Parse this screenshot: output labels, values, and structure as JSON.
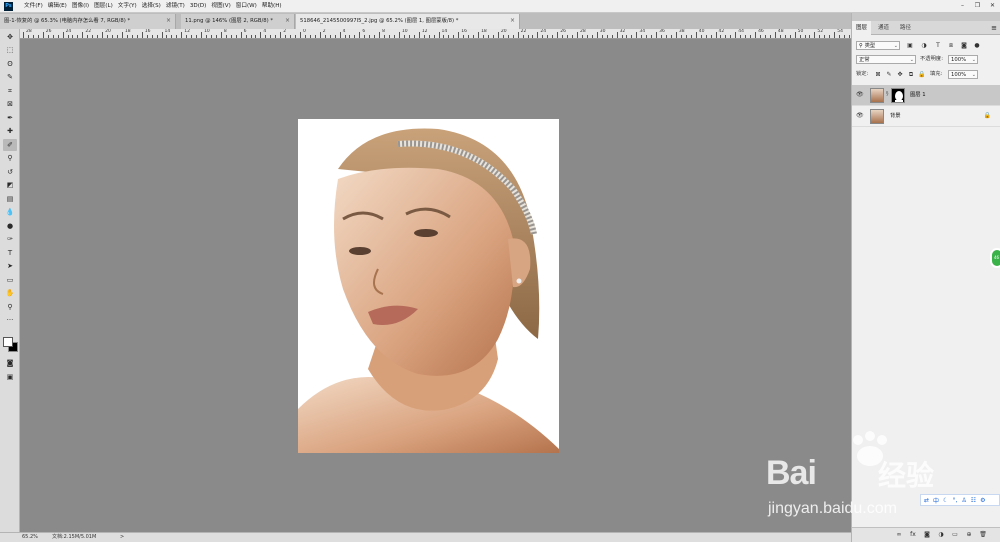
{
  "app": {
    "logo": "Ps",
    "accent": "#31a8ff"
  },
  "menu": [
    "文件(F)",
    "编辑(E)",
    "图像(I)",
    "图层(L)",
    "文字(Y)",
    "选择(S)",
    "滤镜(T)",
    "3D(D)",
    "视图(V)",
    "窗口(W)",
    "帮助(H)"
  ],
  "window_controls": [
    "minimize-icon",
    "restore-icon",
    "close-icon"
  ],
  "tabs": [
    {
      "label": "图-1-恢复的 @ 65.3% (电脑内存怎么看 7, RGB/8) *",
      "close": "×"
    },
    {
      "label": "11.png @ 146% (图层 2, RGB/8) *",
      "close": "×"
    },
    {
      "label": "518646_2145500997I5_2.jpg @ 65.2% (图层 1, 图层蒙版/8) *",
      "close": "×",
      "active": true
    }
  ],
  "ruler": {
    "labels": [
      "28",
      "26",
      "24",
      "22",
      "20",
      "18",
      "16",
      "14",
      "12",
      "10",
      "8",
      "6",
      "4",
      "2",
      "0",
      "2",
      "4",
      "6",
      "8",
      "10",
      "12",
      "14",
      "16",
      "18",
      "20",
      "22",
      "24",
      "26",
      "28",
      "30",
      "32",
      "34",
      "36",
      "38",
      "40",
      "42",
      "44",
      "46",
      "48",
      "50",
      "52",
      "54"
    ]
  },
  "tools": [
    "move-icon",
    "marquee-icon",
    "lasso-icon",
    "quick-select-icon",
    "crop-icon",
    "frame-icon",
    "eyedropper-icon",
    "healing-icon",
    "brush-icon",
    "stamp-icon",
    "history-brush-icon",
    "eraser-icon",
    "gradient-icon",
    "blur-icon",
    "dodge-icon",
    "pen-icon",
    "type-icon",
    "path-select-icon",
    "rectangle-icon",
    "hand-icon",
    "zoom-icon",
    "more-icon"
  ],
  "status": {
    "zoom": "65.2%",
    "doc": "文档:2.15M/5.01M",
    "arrow": ">"
  },
  "panel": {
    "tabs": [
      "图层",
      "通道",
      "路径"
    ],
    "menu": "≡",
    "filter_label": "类型",
    "blend_mode": "正常",
    "opacity_label": "不透明度:",
    "opacity_value": "100%",
    "lock_label": "锁定:",
    "fill_label": "填充:",
    "fill_value": "100%",
    "layers": [
      {
        "name": "图层 1",
        "has_mask": true,
        "selected": true
      },
      {
        "name": "背景",
        "locked": true,
        "selected": false
      }
    ]
  },
  "overlay": {
    "badge": "46",
    "watermark_brand": "Bai",
    "watermark_cn": "经验",
    "watermark_url": "jingyan.baidu.com",
    "ime": [
      "中",
      "☾",
      "°,",
      "♙",
      "☷",
      "⚙"
    ]
  }
}
